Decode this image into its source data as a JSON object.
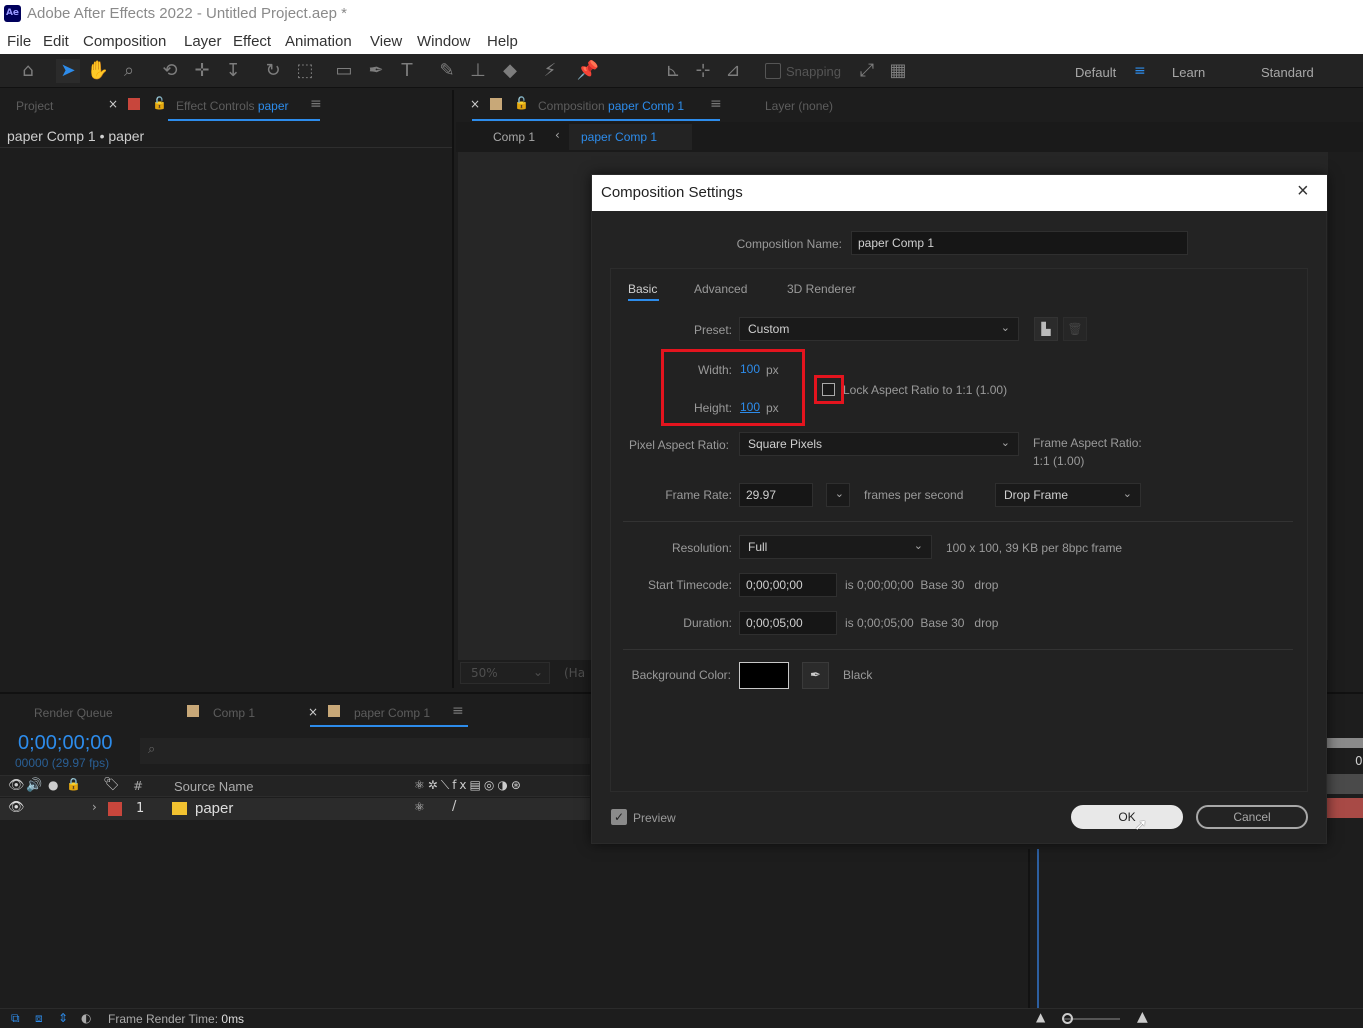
{
  "window": {
    "title": "Adobe After Effects 2022 - Untitled Project.aep *",
    "logo": "Ae"
  },
  "menu": [
    "File",
    "Edit",
    "Composition",
    "Layer",
    "Effect",
    "Animation",
    "View",
    "Window",
    "Help"
  ],
  "toolbar": {
    "snapping": "Snapping",
    "workspaces": [
      "Default",
      "Learn",
      "Standard"
    ]
  },
  "project_panel": {
    "tab_project": "Project",
    "tab_effect_controls": "Effect Controls",
    "effect_target": "paper",
    "breadcrumb": "paper Comp 1 • paper"
  },
  "comp_panel": {
    "tab_label": "Composition",
    "comp_name": "paper Comp 1",
    "layer_tab": "Layer (none)",
    "crumb_comp1": "Comp 1",
    "crumb_active": "paper Comp 1",
    "zoom": "50%",
    "quality": "(Ha"
  },
  "timeline": {
    "tab_render_queue": "Render Queue",
    "tab_comp1": "Comp 1",
    "tab_paper_comp": "paper Comp 1",
    "timecode": "0;00;00;00",
    "frames": "00000 (29.97 fps)",
    "col_hash": "#",
    "col_source": "Source Name",
    "layer_num": "1",
    "layer_name": "paper",
    "ruler_label": "0"
  },
  "status": {
    "label": "Frame Render Time:",
    "value": "0ms"
  },
  "dialog": {
    "title": "Composition Settings",
    "comp_name_label": "Composition Name:",
    "comp_name_value": "paper Comp 1",
    "tabs": [
      "Basic",
      "Advanced",
      "3D Renderer"
    ],
    "preset_label": "Preset:",
    "preset_value": "Custom",
    "width_label": "Width:",
    "width_value": "100",
    "width_unit": "px",
    "height_label": "Height:",
    "height_value": "100",
    "height_unit": "px",
    "lock_label": "Lock Aspect Ratio to 1:1 (1.00)",
    "par_label": "Pixel Aspect Ratio:",
    "par_value": "Square Pixels",
    "far_label": "Frame Aspect Ratio:",
    "far_value": "1:1 (1.00)",
    "fr_label": "Frame Rate:",
    "fr_value": "29.97",
    "fps_label": "frames per second",
    "drop_value": "Drop Frame",
    "res_label": "Resolution:",
    "res_value": "Full",
    "res_info": "100 x 100, 39 KB per 8bpc frame",
    "st_label": "Start Timecode:",
    "st_value": "0;00;00;00",
    "st_info": "is 0;00;00;00  Base 30   drop",
    "dur_label": "Duration:",
    "dur_value": "0;00;05;00",
    "dur_info": "is 0;00;05;00  Base 30   drop",
    "bg_label": "Background Color:",
    "bg_name": "Black",
    "preview_label": "Preview",
    "ok_label": "OK",
    "cancel_label": "Cancel"
  },
  "colors": {
    "accent": "#2d8ceb",
    "highlight": "#e4141e",
    "layer_label": "#f2c230",
    "layer_red": "#c8463c"
  }
}
